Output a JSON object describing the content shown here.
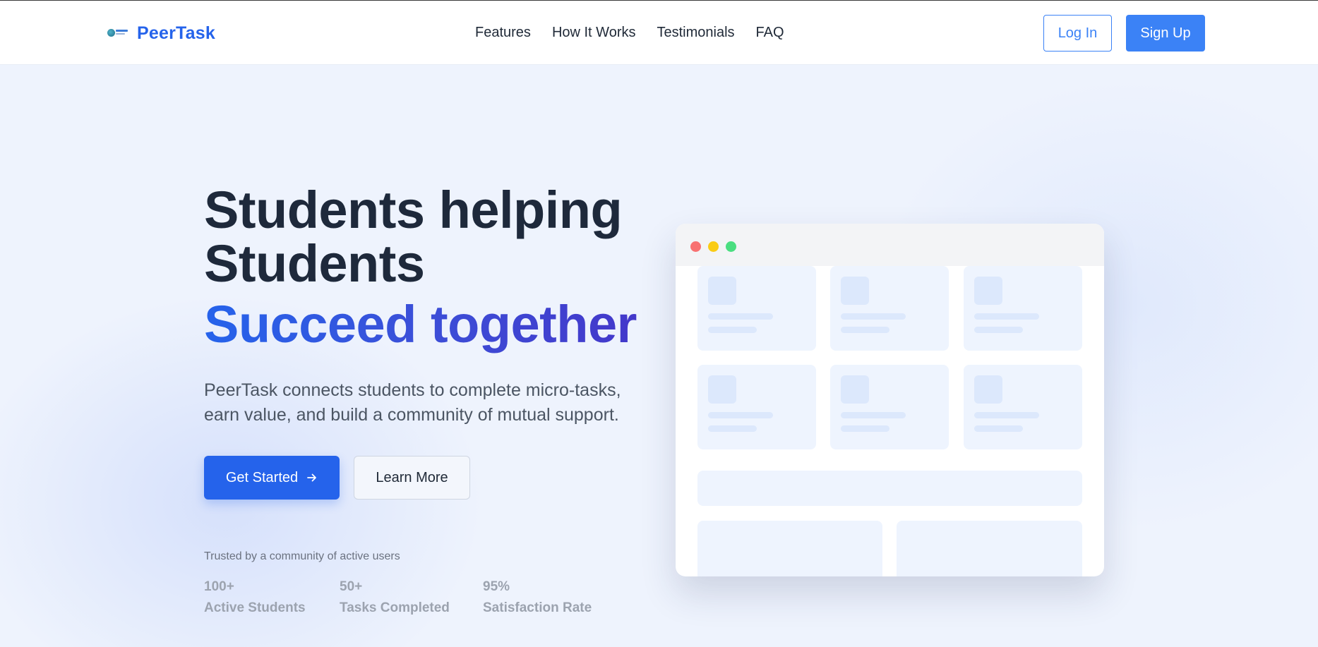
{
  "header": {
    "brand": "PeerTask",
    "nav": [
      "Features",
      "How It Works",
      "Testimonials",
      "FAQ"
    ],
    "login_label": "Log In",
    "signup_label": "Sign Up"
  },
  "hero": {
    "headline_line1": "Students helping",
    "headline_line2": "Students",
    "headline_accent": "Succeed together",
    "subtitle": "PeerTask connects students to complete micro-tasks, earn value, and build a community of mutual support.",
    "primary_cta": "Get Started",
    "secondary_cta": "Learn More",
    "trusted_text": "Trusted by a community of active users",
    "stats": [
      {
        "value": "100+",
        "label": "Active Students"
      },
      {
        "value": "50+",
        "label": "Tasks Completed"
      },
      {
        "value": "95%",
        "label": "Satisfaction Rate"
      }
    ]
  },
  "icons": {
    "cta_arrow": "arrow-right-icon",
    "window_controls": [
      "red",
      "yellow",
      "green"
    ]
  },
  "colors": {
    "brand": "#2563eb",
    "accent_button": "#3b82f6",
    "heading": "#1e293b",
    "background": "#eef3fd"
  }
}
